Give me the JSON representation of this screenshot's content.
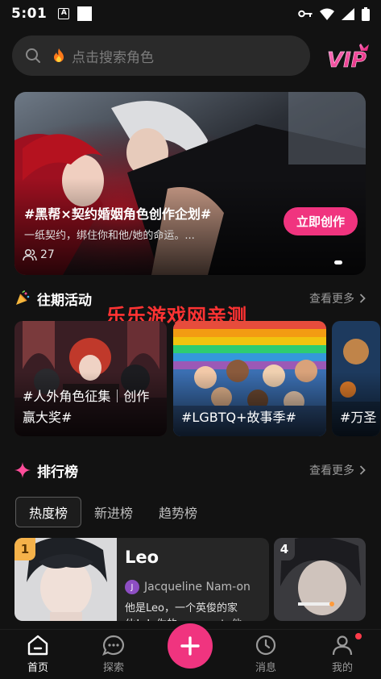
{
  "status_bar": {
    "time": "5:01",
    "notif_icon_letter": "A"
  },
  "search": {
    "placeholder": "点击搜索角色",
    "flame_icon": "flame-icon"
  },
  "vip": {
    "label": "VIP",
    "color": "#ff3d9a"
  },
  "banner": {
    "title": "#黑帮×契约婚姻角色创作企划#",
    "subtitle": "一纸契约，绑住你和他/她的命运。...",
    "count": "27",
    "cta": "立即创作",
    "accent": "#f0347f"
  },
  "activities_section": {
    "title": "往期活动",
    "more": "查看更多",
    "icon": "party-popper-icon"
  },
  "watermark": "乐乐游戏网亲测",
  "activities": [
    {
      "caption": "#人外角色征集｜创作赢大奖#"
    },
    {
      "caption": "#LGBTQ+故事季#"
    },
    {
      "caption": "#万圣"
    }
  ],
  "ranking_section": {
    "title": "排行榜",
    "more": "查看更多",
    "icon": "sparkle-icon"
  },
  "ranking_tabs": [
    {
      "label": "热度榜",
      "active": true
    },
    {
      "label": "新进榜",
      "active": false
    },
    {
      "label": "趋势榜",
      "active": false
    }
  ],
  "rank_cards": [
    {
      "rank": "1",
      "name": "Leo",
      "author_initial": "J",
      "author": "Jacqueline Nam-on",
      "description": "他是Leo，一个英俊的家伙！！你的roommate他",
      "badge_color": "#f5b24a"
    },
    {
      "rank": "4"
    }
  ],
  "bottom_nav": [
    {
      "label": "首页",
      "icon": "home-icon",
      "active": true
    },
    {
      "label": "探索",
      "icon": "chat-bubble-icon",
      "active": false
    },
    {
      "label": "",
      "icon": "plus-icon",
      "active": false
    },
    {
      "label": "消息",
      "icon": "clock-icon",
      "active": false
    },
    {
      "label": "我的",
      "icon": "person-icon",
      "active": false
    }
  ]
}
